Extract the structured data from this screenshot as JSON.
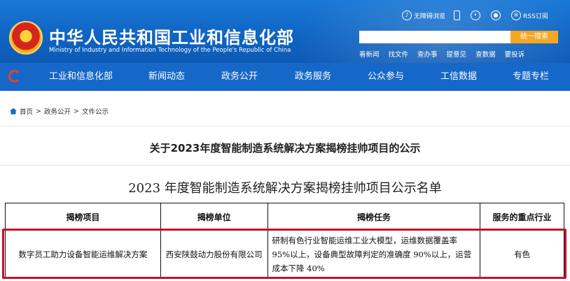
{
  "header": {
    "site_name": "中华人民共和国工业和信息化部",
    "site_name_en": "Ministry of Industry and Information Technology of the People's Republic of China",
    "top_links": [
      {
        "label": "无障碍浏览",
        "icon": "accessibility-icon"
      },
      {
        "label": "",
        "icon": "mobile-icon"
      },
      {
        "label": "",
        "icon": "wechat-icon"
      },
      {
        "label": "",
        "icon": "weibo-icon"
      },
      {
        "label": "RSS订阅",
        "icon": "rss-icon"
      }
    ],
    "search_placeholder": "",
    "search_button": "统一搜索",
    "quick_links": [
      "看新闻",
      "找文件",
      "查办事",
      "提意见",
      "查数据",
      "要投诉"
    ]
  },
  "nav": {
    "items": [
      "工业和信息化部",
      "新闻动态",
      "政务公开",
      "政务服务",
      "公众参与",
      "工信数据",
      "专题专栏"
    ]
  },
  "breadcrumb": {
    "items": [
      "首页",
      "政务公开",
      "文件公示"
    ],
    "separator": ">"
  },
  "article": {
    "title": "关于2023年度智能制造系统解决方案揭榜挂帅项目的公示",
    "list_title": "2023 年度智能制造系统解决方案揭榜挂帅项目公示名单"
  },
  "table": {
    "headers": [
      "揭榜项目",
      "揭榜单位",
      "揭榜任务",
      "服务的重点行业"
    ],
    "rows": [
      {
        "project": "数字员工助力设备智能运维解决方案",
        "unit": "西安陕鼓动力股份有限公司",
        "task": "研制有色行业智能运维工业大模型，运维数据覆盖率 95%以上，设备典型故障判定的准确度 90%以上，运营成本下降 40%",
        "industry": "有色"
      }
    ]
  },
  "colors": {
    "header_blue": "#1668c8",
    "search_button": "#f5a623",
    "highlight_red": "#c0142b"
  }
}
